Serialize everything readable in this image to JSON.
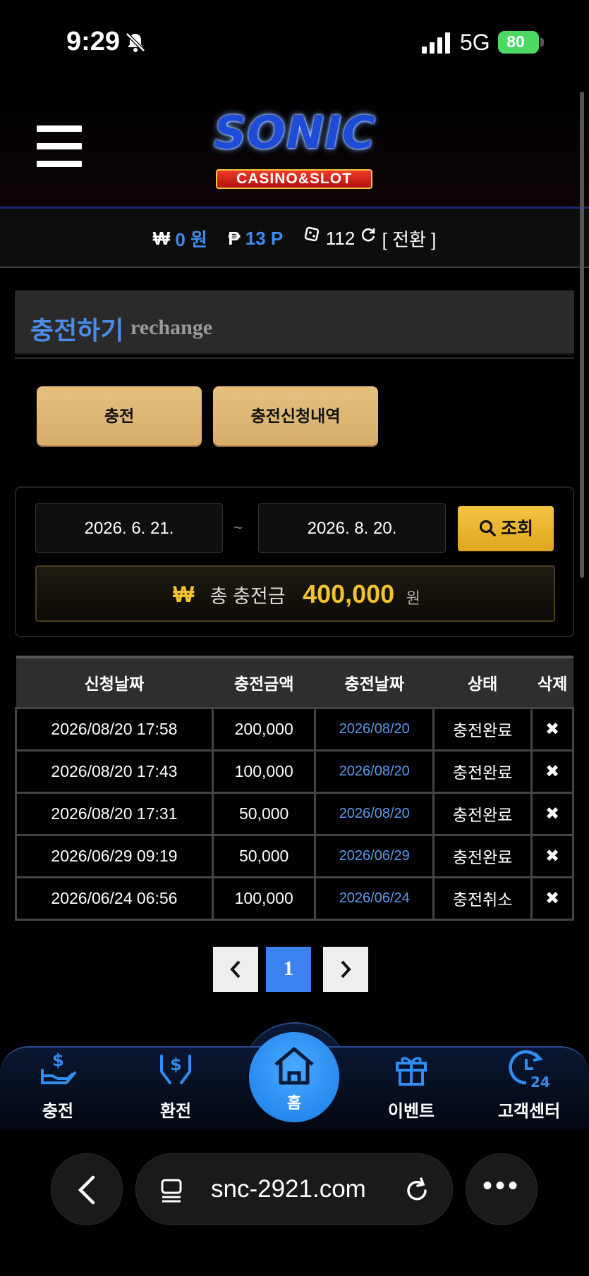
{
  "status_bar": {
    "time": "9:29",
    "network": "5G",
    "battery": "80"
  },
  "header": {
    "logo_text": "SONIC",
    "logo_sub": "CASINO&SLOT"
  },
  "balance": {
    "won_symbol": "₩",
    "won_value": "0 원",
    "point_symbol": "₱",
    "point_value": "13 P",
    "chip_value": "112",
    "convert_label": "[ 전환 ]"
  },
  "section": {
    "title": "충전하기",
    "subtitle": "rechange"
  },
  "tabs": {
    "charge": "충전",
    "history": "충전신청내역"
  },
  "search": {
    "start_date": "2026. 6. 21.",
    "separator": "~",
    "end_date": "2026. 8. 20.",
    "button_label": "조회"
  },
  "total": {
    "symbol": "₩",
    "label": "총 충전금",
    "value": "400,000",
    "unit": "원"
  },
  "table": {
    "headers": [
      "신청날짜",
      "충전금액",
      "충전날짜",
      "상태",
      "삭제"
    ],
    "rows": [
      {
        "request_date": "2026/08/20 17:58",
        "amount": "200,000",
        "charge_date": "2026/08/20",
        "status": "충전완료",
        "delete": "✖"
      },
      {
        "request_date": "2026/08/20 17:43",
        "amount": "100,000",
        "charge_date": "2026/08/20",
        "status": "충전완료",
        "delete": "✖"
      },
      {
        "request_date": "2026/08/20 17:31",
        "amount": "50,000",
        "charge_date": "2026/08/20",
        "status": "충전완료",
        "delete": "✖"
      },
      {
        "request_date": "2026/06/29 09:19",
        "amount": "50,000",
        "charge_date": "2026/06/29",
        "status": "충전완료",
        "delete": "✖"
      },
      {
        "request_date": "2026/06/24 06:56",
        "amount": "100,000",
        "charge_date": "2026/06/24",
        "status": "충전취소",
        "delete": "✖"
      }
    ]
  },
  "pagination": {
    "prev": "‹",
    "current": "1",
    "next": "›"
  },
  "bottom_nav": {
    "charge": "충전",
    "exchange": "환전",
    "home": "홈",
    "event": "이벤트",
    "support": "고객센터"
  },
  "browser": {
    "url": "snc-2921.com",
    "more": "•••"
  },
  "colors": {
    "accent_blue": "#3b82f0",
    "gold": "#f2c230",
    "button_tan": "#e5c07e"
  }
}
